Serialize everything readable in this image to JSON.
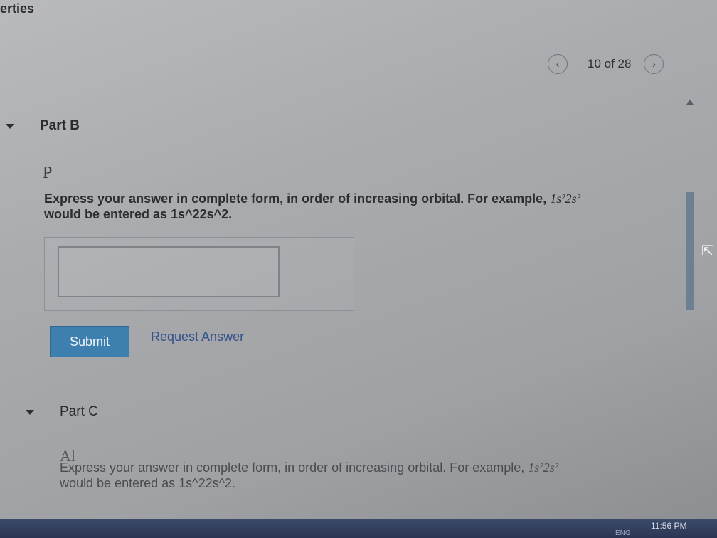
{
  "page": {
    "title_fragment": "erties"
  },
  "pager": {
    "prev_icon": "chevron-left-icon",
    "label": "10 of 28",
    "next_icon": "chevron-right-icon"
  },
  "part_b": {
    "title": "Part B",
    "symbol": "P",
    "instruction_line1": "Express your answer in complete form, in order of increasing orbital. For example,",
    "instruction_example": "1s²2s²",
    "instruction_line2": "would be entered as 1s^22s^2.",
    "answer_value": "",
    "submit_label": "Submit",
    "request_answer_label": "Request Answer"
  },
  "part_c": {
    "title": "Part C",
    "symbol": "Al",
    "instruction_line1": "Express your answer in complete form, in order of increasing orbital. For example,",
    "instruction_example": "1s²2s²",
    "instruction_line2": "would be entered as 1s^22s^2."
  },
  "taskbar": {
    "lang": "ENG",
    "time": "11:56 PM"
  },
  "colors": {
    "submit_bg": "#3d7fae",
    "link": "#34538a",
    "scroll_thumb": "#6e7f93"
  }
}
